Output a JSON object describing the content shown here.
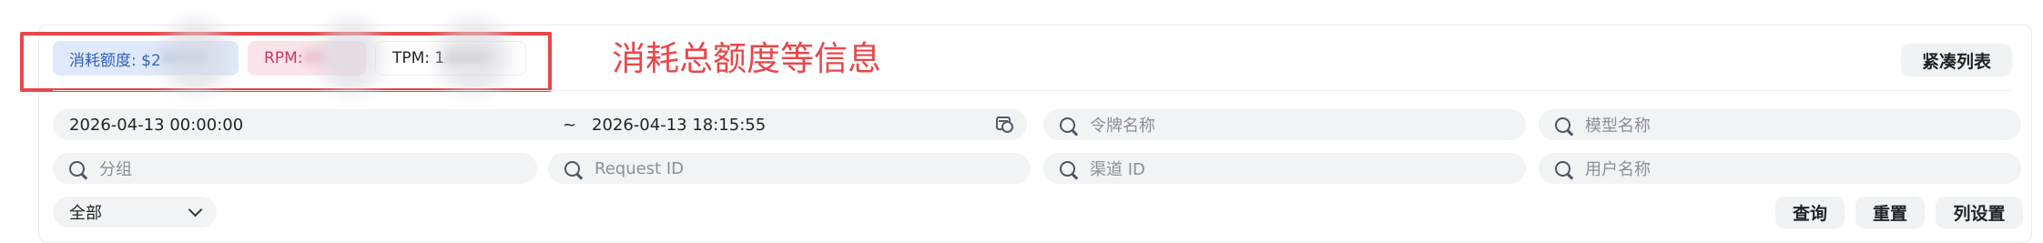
{
  "stats": {
    "quota_label": "消耗额度: $2",
    "quota_hidden": "0000",
    "rpm_label": "RPM: ",
    "rpm_hidden": "00",
    "tpm_label": "TPM: 1",
    "tpm_hidden": "0000"
  },
  "annotation": "消耗总额度等信息",
  "toolbar": {
    "compact_label": "紧凑列表"
  },
  "filters": {
    "date_start": "2026-04-13 00:00:00",
    "date_separator": "~",
    "date_end": "2026-04-13 18:15:55",
    "token_placeholder": "令牌名称",
    "model_placeholder": "模型名称",
    "group_placeholder": "分组",
    "request_placeholder": "Request ID",
    "channel_placeholder": "渠道 ID",
    "user_placeholder": "用户名称",
    "type_select_value": "全部"
  },
  "actions": {
    "query_label": "查询",
    "reset_label": "重置",
    "columns_label": "列设置"
  },
  "colors": {
    "annotation_red": "#e8474a",
    "quota_tag_bg": "#dfe9fb",
    "rpm_tag_bg": "#fbe3ea"
  }
}
